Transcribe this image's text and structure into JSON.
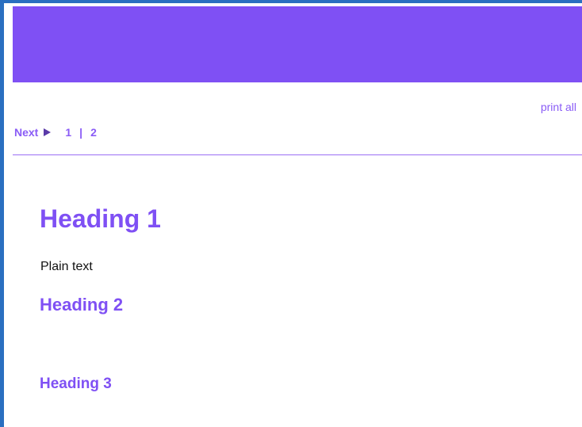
{
  "header": {
    "banner_color": "#7f50f4"
  },
  "toolbar": {
    "print_all_label": "print all"
  },
  "pager": {
    "next_label": "Next",
    "next_icon": "play-arrow-icon",
    "pages": [
      "1",
      "2"
    ],
    "separator": "|"
  },
  "content": {
    "heading1": "Heading 1",
    "plain_text": "Plain text",
    "heading2": "Heading 2",
    "heading3": "Heading 3"
  },
  "colors": {
    "accent": "#7f50f4",
    "link": "#8a5cf6",
    "frame_border": "#2a6fc0",
    "body_text": "#111111"
  }
}
